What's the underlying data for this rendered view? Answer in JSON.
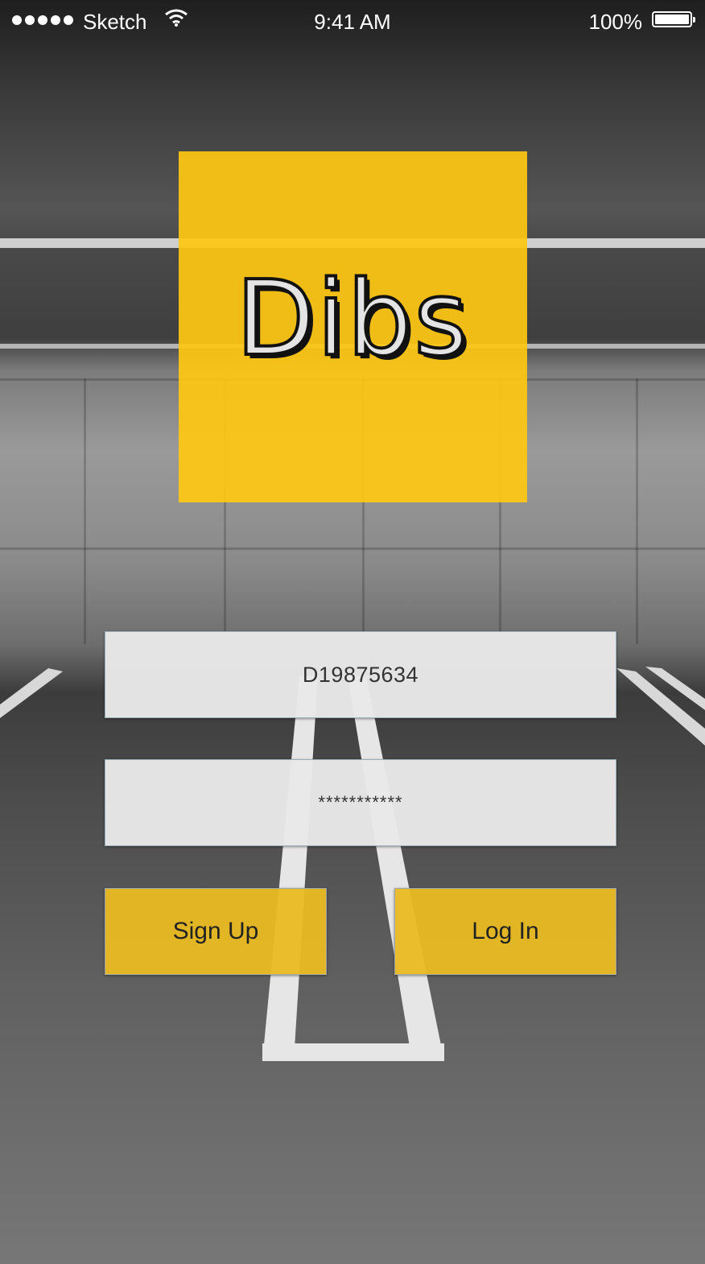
{
  "status_bar": {
    "carrier": "Sketch",
    "time": "9:41 AM",
    "battery_percent": "100%",
    "signal_icon": "signal-dots-icon",
    "wifi_icon": "wifi-icon",
    "battery_icon": "battery-icon"
  },
  "logo": {
    "text": "Dibs",
    "tile_color": "#FFC814"
  },
  "login_form": {
    "username_value": "D19875634",
    "password_value": "***********"
  },
  "actions": {
    "signup_label": "Sign Up",
    "login_label": "Log In",
    "button_color": "#EABA22"
  }
}
